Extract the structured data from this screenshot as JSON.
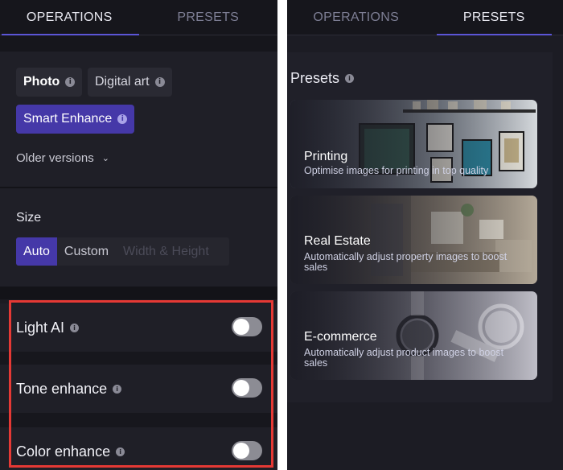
{
  "left": {
    "tabs": [
      {
        "label": "OPERATIONS",
        "active": true
      },
      {
        "label": "PRESETS",
        "active": false
      }
    ],
    "mode_chips": {
      "photo": "Photo",
      "digital_art": "Digital art",
      "smart_enhance": "Smart Enhance"
    },
    "older_versions": "Older versions",
    "size": {
      "title": "Size",
      "options": {
        "auto": "Auto",
        "custom": "Custom",
        "width_height": "Width & Height"
      },
      "selected": "Auto"
    },
    "toggles": [
      {
        "label": "Light AI",
        "on": false
      },
      {
        "label": "Tone enhance",
        "on": false
      },
      {
        "label": "Color enhance",
        "on": false
      }
    ]
  },
  "right": {
    "tabs": [
      {
        "label": "OPERATIONS",
        "active": false
      },
      {
        "label": "PRESETS",
        "active": true
      }
    ],
    "presets_title": "Presets",
    "cards": [
      {
        "title": "Printing",
        "description": "Optimise images for printing in top quality"
      },
      {
        "title": "Real Estate",
        "description": "Automatically adjust property images to boost sales"
      },
      {
        "title": "E-commerce",
        "description": "Automatically adjust product images to boost sales"
      }
    ]
  },
  "colors": {
    "accent": "#4538a8",
    "tab_underline": "#5b55d6",
    "highlight": "#e53935",
    "panel_bg": "#1b1b22"
  },
  "icons": {
    "info": "info-icon",
    "chevron": "chevron-down-icon"
  }
}
